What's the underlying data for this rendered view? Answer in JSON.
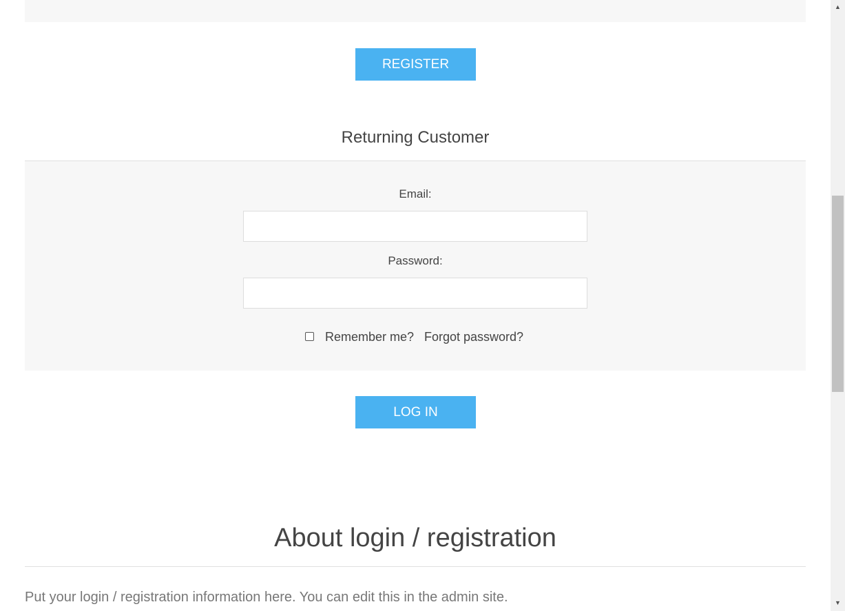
{
  "register_section": {
    "button_label": "REGISTER"
  },
  "login_section": {
    "title": "Returning Customer",
    "email_label": "Email:",
    "email_value": "",
    "password_label": "Password:",
    "password_value": "",
    "remember_label": "Remember me?",
    "remember_checked": false,
    "forgot_label": "Forgot password?",
    "button_label": "LOG IN"
  },
  "about_section": {
    "title": "About login / registration",
    "text": "Put your login / registration information here. You can edit this in the admin site."
  },
  "scrollbar": {
    "up_icon": "triangle-up-icon",
    "down_icon": "triangle-down-icon"
  },
  "colors": {
    "button_background": "#4ab2f1",
    "panel_background": "#f7f7f7",
    "text": "#444444",
    "muted_text": "#777777"
  }
}
